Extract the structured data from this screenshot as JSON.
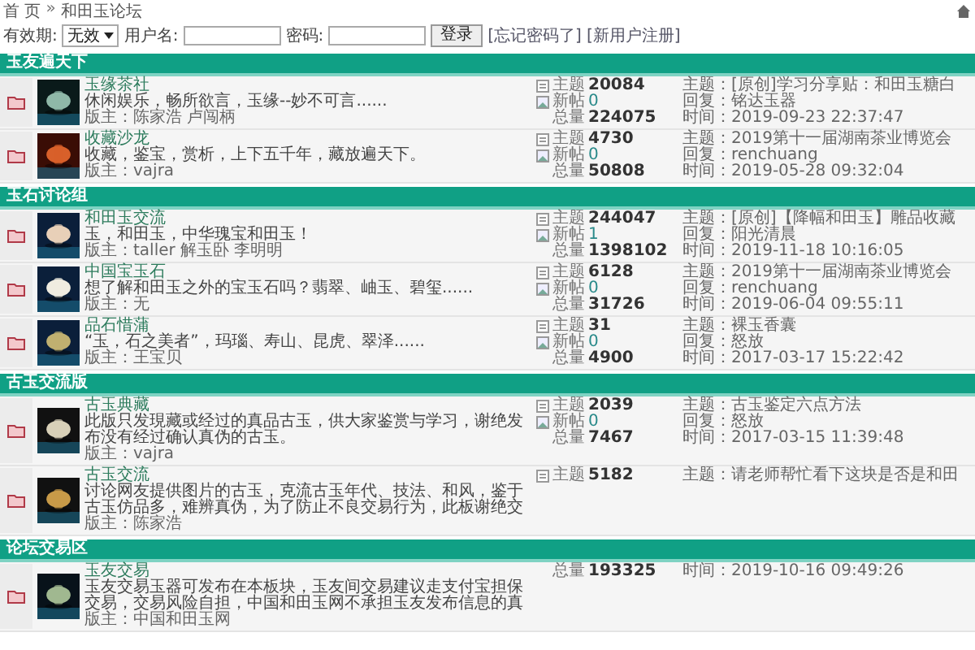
{
  "breadcrumb": {
    "home": "首 页",
    "separator": "»",
    "current": "和田玉论坛"
  },
  "login": {
    "expiry_label": "有效期:",
    "expiry_value": "无效",
    "username_label": "用户名:",
    "password_label": "密码:",
    "button": "登录",
    "links": [
      "[忘记密码了]",
      "[新用户注册]"
    ]
  },
  "sections": [
    {
      "title": "玉友遍天下",
      "forums": [
        {
          "name": "玉缘茶社",
          "description": "休闲娱乐，畅所欲言，玉缘--妙不可言......",
          "moderators": "版主：陈家浩 卢闯柄",
          "stats": [
            {
              "kind": "topics",
              "label": "主题",
              "value": "20084"
            },
            {
              "kind": "new",
              "label": "新帖",
              "value": "0"
            },
            {
              "kind": "total",
              "label": "总量",
              "value": "224075"
            }
          ],
          "last_post": [
            "主题：[原创]学习分享贴：和田玉糖白",
            "回复：铭达玉器",
            "时间：2019-09-23 22:37:47"
          ]
        },
        {
          "name": "收藏沙龙",
          "description": "收藏，鉴宝，赏析，上下五千年，藏放遍天下。",
          "moderators": "版主：vajra",
          "stats": [
            {
              "kind": "topics",
              "label": "主题",
              "value": "4730"
            },
            {
              "kind": "new",
              "label": "新帖",
              "value": "0"
            },
            {
              "kind": "total",
              "label": "总量",
              "value": "50808"
            }
          ],
          "last_post": [
            "主题：2019第十一届湖南茶业博览会",
            "回复：renchuang",
            "时间：2019-05-28 09:32:04"
          ]
        }
      ]
    },
    {
      "title": "玉石讨论组",
      "forums": [
        {
          "name": "和田玉交流",
          "description": "玉，和田玉，中华瑰宝和田玉！",
          "moderators": "版主：taller 解玉卧 李明明",
          "stats": [
            {
              "kind": "topics",
              "label": "主题",
              "value": "244047"
            },
            {
              "kind": "new",
              "label": "新帖",
              "value": "1"
            },
            {
              "kind": "total",
              "label": "总量",
              "value": "1398102"
            }
          ],
          "last_post": [
            "主题：[原创]【降幅和田玉】雕品收藏",
            "回复：阳光清晨",
            "时间：2019-11-18 10:16:05"
          ]
        },
        {
          "name": "中国宝玉石",
          "description": "想了解和田玉之外的宝玉石吗？翡翠、岫玉、碧玺......",
          "moderators": "版主：无",
          "stats": [
            {
              "kind": "topics",
              "label": "主题",
              "value": "6128"
            },
            {
              "kind": "new",
              "label": "新帖",
              "value": "0"
            },
            {
              "kind": "total",
              "label": "总量",
              "value": "31726"
            }
          ],
          "last_post": [
            "主题：2019第十一届湖南茶业博览会",
            "回复：renchuang",
            "时间：2019-06-04 09:55:11"
          ]
        },
        {
          "name": "品石惜蒲",
          "description": "“玉，石之美者”，玛瑙、寿山、昆虎、翠泽......",
          "moderators": "版主：王宝贝",
          "stats": [
            {
              "kind": "topics",
              "label": "主题",
              "value": "31"
            },
            {
              "kind": "new",
              "label": "新帖",
              "value": "0"
            },
            {
              "kind": "total",
              "label": "总量",
              "value": "4900"
            }
          ],
          "last_post": [
            "主题：裸玉香囊",
            "回复：怒放",
            "时间：2017-03-17 15:22:42"
          ]
        }
      ]
    },
    {
      "title": "古玉交流版",
      "forums": [
        {
          "name": "古玉典藏",
          "description": "此版只发現藏或经过的真品古玉，供大家鉴赏与学习，谢绝发布没有经过确认真伪的古玉。",
          "moderators": "版主：vajra",
          "stats": [
            {
              "kind": "topics",
              "label": "主题",
              "value": "2039"
            },
            {
              "kind": "new",
              "label": "新帖",
              "value": "0"
            },
            {
              "kind": "total",
              "label": "总量",
              "value": "7467"
            }
          ],
          "last_post": [
            "主题：古玉鉴定六点方法",
            "回复：怒放",
            "时间：2017-03-15 11:39:48"
          ]
        },
        {
          "name": "古玉交流",
          "description": "讨论网友提供图片的古玉，克流古玉年代、技法、和风，鉴于古玉仿品多，难辨真伪，为了防止不良交易行为，此板谢绝交",
          "moderators": "版主：陈家浩",
          "stats": [
            {
              "kind": "topics",
              "label": "主题",
              "value": "5182"
            }
          ],
          "last_post": [
            "主题：请老师帮忙看下这块是否是和田"
          ]
        }
      ]
    },
    {
      "title": "论坛交易区",
      "forums": [
        {
          "name": "玉友交易",
          "description": "玉友交易玉器可发布在本板块，玉友间交易建议走支付宝担保交易，交易风险自担，中国和田玉网不承担玉友发布信息的真",
          "moderators": "版主：中国和田玉网",
          "stats": [
            {
              "kind": "total",
              "label": "总量",
              "value": "193325"
            }
          ],
          "last_post": [
            "时间：2019-10-16 09:49:26"
          ]
        }
      ]
    }
  ]
}
